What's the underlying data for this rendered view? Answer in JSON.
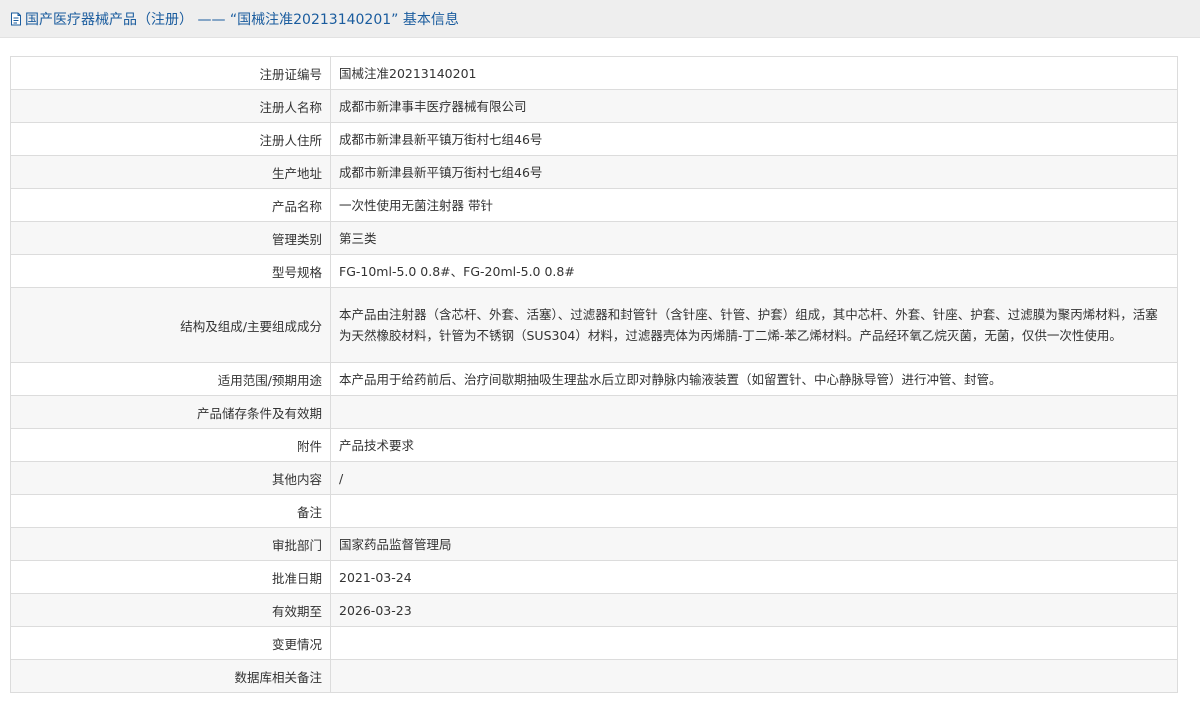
{
  "header": {
    "title": "国产医疗器械产品（注册） —— “国械注准20213140201” 基本信息",
    "icon": "document-icon"
  },
  "rows": [
    {
      "label": "注册证编号",
      "value": "国械注准20213140201"
    },
    {
      "label": "注册人名称",
      "value": "成都市新津事丰医疗器械有限公司"
    },
    {
      "label": "注册人住所",
      "value": "成都市新津县新平镇万街村七组46号"
    },
    {
      "label": "生产地址",
      "value": "成都市新津县新平镇万街村七组46号"
    },
    {
      "label": "产品名称",
      "value": "一次性使用无菌注射器 带针"
    },
    {
      "label": "管理类别",
      "value": "第三类"
    },
    {
      "label": "型号规格",
      "value": "FG-10ml-5.0 0.8#、FG-20ml-5.0 0.8#"
    },
    {
      "label": "结构及组成/主要组成成分",
      "value": "本产品由注射器（含芯杆、外套、活塞）、过滤器和封管针（含针座、针管、护套）组成，其中芯杆、外套、针座、护套、过滤膜为聚丙烯材料，活塞为天然橡胶材料，针管为不锈钢（SUS304）材料，过滤器壳体为丙烯腈-丁二烯-苯乙烯材料。产品经环氧乙烷灭菌，无菌，仅供一次性使用。"
    },
    {
      "label": "适用范围/预期用途",
      "value": "本产品用于给药前后、治疗间歇期抽吸生理盐水后立即对静脉内输液装置（如留置针、中心静脉导管）进行冲管、封管。"
    },
    {
      "label": "产品储存条件及有效期",
      "value": ""
    },
    {
      "label": "附件",
      "value": "产品技术要求"
    },
    {
      "label": "其他内容",
      "value": "/"
    },
    {
      "label": "备注",
      "value": ""
    },
    {
      "label": "审批部门",
      "value": "国家药品监督管理局"
    },
    {
      "label": "批准日期",
      "value": "2021-03-24"
    },
    {
      "label": "有效期至",
      "value": "2026-03-23"
    },
    {
      "label": "变更情况",
      "value": ""
    },
    {
      "label": "数据库相关备注",
      "value": ""
    }
  ]
}
